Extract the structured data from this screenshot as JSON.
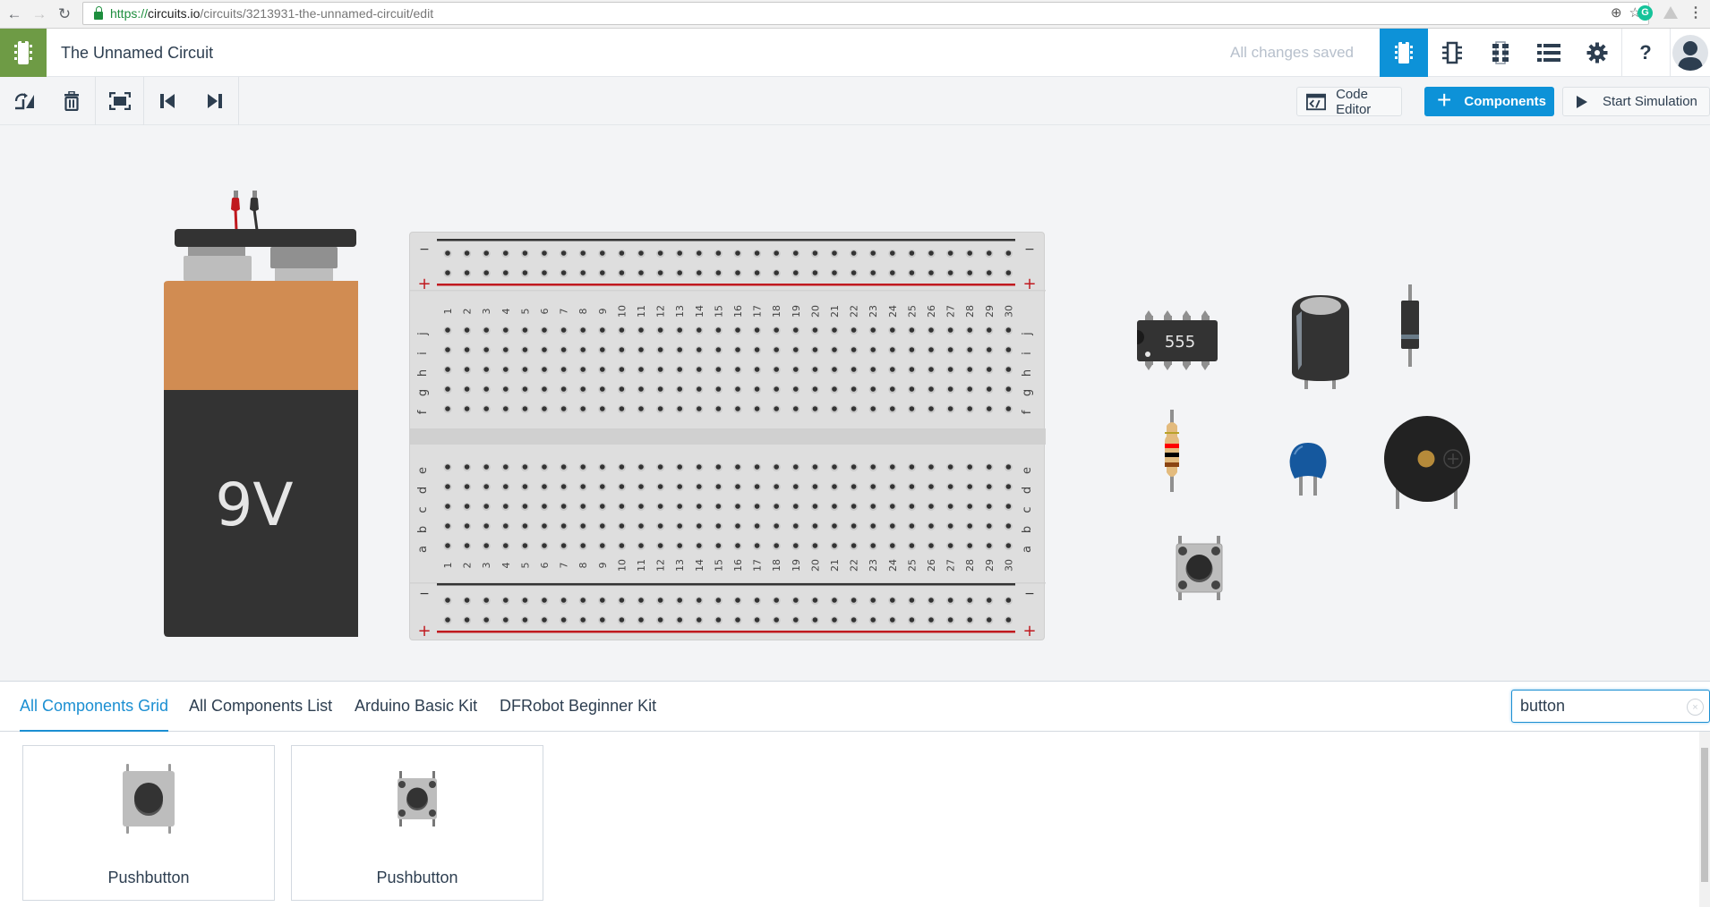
{
  "browser": {
    "url_scheme": "https://",
    "url_host": "circuits.io",
    "url_path": "/circuits/3213931-the-unnamed-circuit/edit",
    "back_icon": "←",
    "forward_icon": "→",
    "reload_icon": "↻",
    "zoom_icon": "⊕",
    "star_icon": "☆",
    "ext_grammarly": "G",
    "menu_icon": "⋮"
  },
  "header": {
    "title": "The Unnamed Circuit",
    "status": "All changes saved",
    "views": [
      {
        "name": "breadboard-view",
        "active": true
      },
      {
        "name": "schematic-view",
        "active": false
      },
      {
        "name": "pcb-view",
        "active": false
      },
      {
        "name": "component-list",
        "active": false
      }
    ],
    "help_label": "?"
  },
  "toolbar": {
    "code_editor_label": "Code Editor",
    "components_label": "Components",
    "start_simulation_label": "Start Simulation"
  },
  "canvas": {
    "battery_label": "9V",
    "ic_label": "555",
    "breadboard": {
      "columns": 30,
      "top_rows": [
        "j",
        "i",
        "h",
        "g",
        "f"
      ],
      "bottom_rows": [
        "e",
        "d",
        "c",
        "b",
        "a"
      ],
      "minus_label": "−",
      "plus_label": "+"
    },
    "colors": {
      "battery_top": "#d18c52",
      "battery_body": "#333333",
      "rail_red": "#c0191f",
      "rail_black": "#333333"
    }
  },
  "tabs": [
    {
      "label": "All Components Grid",
      "active": true
    },
    {
      "label": "All Components List",
      "active": false
    },
    {
      "label": "Arduino Basic Kit",
      "active": false
    },
    {
      "label": "DFRobot Beginner Kit",
      "active": false
    }
  ],
  "search": {
    "value": "button",
    "clear_icon": "×"
  },
  "results": [
    {
      "label": "Pushbutton"
    },
    {
      "label": "Pushbutton"
    }
  ],
  "accent": "#0d92d8"
}
